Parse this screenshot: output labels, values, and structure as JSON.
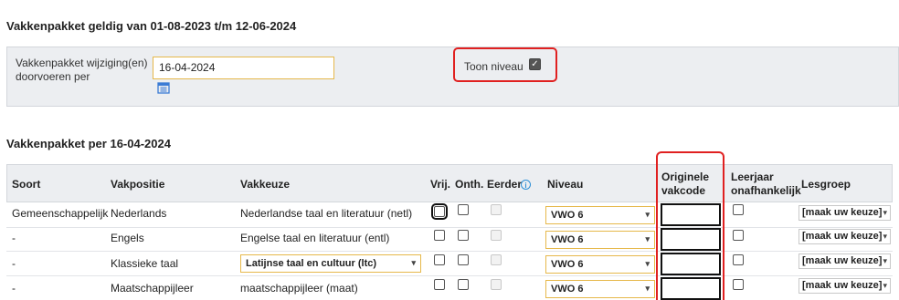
{
  "page": {
    "title": "Vakkenpakket geldig van 01-08-2023 t/m 12-06-2024",
    "section_title": "Vakkenpakket per 16-04-2024"
  },
  "filter": {
    "label": "Vakkenpakket wijziging(en) doorvoeren per",
    "date_value": "16-04-2024",
    "calendar_icon": "calendar-icon",
    "toon_niveau_label": "Toon niveau",
    "toon_niveau_checked": true
  },
  "table": {
    "headers": {
      "soort": "Soort",
      "vakpositie": "Vakpositie",
      "vakkeuze": "Vakkeuze",
      "vrij": "Vrij.",
      "onth": "Onth.",
      "eerder": "Eerder",
      "niveau": "Niveau",
      "originele_vakcode": "Originele vakcode",
      "leerjaar": "Leerjaar onafhankelijk",
      "lesgroep": "Lesgroep"
    },
    "rows": [
      {
        "soort": "Gemeenschappelijk",
        "vakpositie": "Nederlands",
        "vakkeuze": "Nederlandse taal en literatuur (netl)",
        "niveau": "VWO 6",
        "lesgroep": "[maak uw keuze]"
      },
      {
        "soort": "-",
        "vakpositie": "Engels",
        "vakkeuze": "Engelse taal en literatuur (entl)",
        "niveau": "VWO 6",
        "lesgroep": "[maak uw keuze]"
      },
      {
        "soort": "-",
        "vakpositie": "Klassieke taal",
        "vakkeuze": "Latijnse taal en cultuur (ltc)",
        "niveau": "VWO 6",
        "lesgroep": "[maak uw keuze]"
      },
      {
        "soort": "-",
        "vakpositie": "Maatschappijleer",
        "vakkeuze": "maatschappijleer (maat)",
        "niveau": "VWO 6",
        "lesgroep": "[maak uw keuze]"
      }
    ]
  },
  "colors": {
    "highlight": "#e02020",
    "input_border": "#e6b84a",
    "info": "#2d8fd6"
  }
}
